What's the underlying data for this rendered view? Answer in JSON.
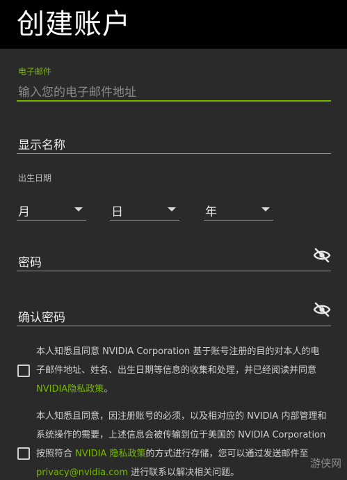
{
  "header": {
    "title": "创建账户"
  },
  "email": {
    "label": "电子邮件",
    "placeholder": "输入您的电子邮件地址"
  },
  "display_name": {
    "label": "显示名称"
  },
  "birthdate": {
    "label": "出生日期",
    "month": "月",
    "day": "日",
    "year": "年"
  },
  "password": {
    "label": "密码"
  },
  "confirm_password": {
    "label": "确认密码"
  },
  "consent1": {
    "text_a": "本人知悉且同意 NVIDIA Corporation 基于账号注册的目的对本人的电子邮件地址、姓名、出生日期等信息的收集和处理，并已经阅读并同意 ",
    "link": "NVIDIA隐私政策",
    "text_b": "。"
  },
  "consent2": {
    "text_a": "本人知悉且同意，因注册账号的必须，以及相对应的 NVIDIA 内部管理和系统操作的需要，上述信息会被传输到位于美国的 NVIDIA Corporation 按照符合 ",
    "link": "NVIDIA 隐私政策",
    "text_b": "的方式进行存储，您可以通过发送邮件至 ",
    "email_link": "privacy@nvidia.com",
    "text_c": " 进行联系以解决相关问题。"
  },
  "watermark": "游侠网",
  "colors": {
    "accent": "#76b900",
    "background": "#2a2a2a",
    "header": "#000000"
  }
}
